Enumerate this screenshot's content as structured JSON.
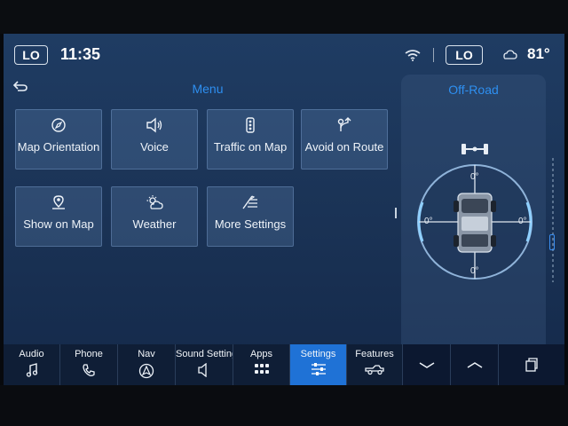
{
  "status": {
    "left_temp_zone": "LO",
    "time": "11:35",
    "right_temp_zone": "LO",
    "outside_temp": "81°"
  },
  "header": {
    "title": "Menu"
  },
  "tiles": [
    {
      "label": "Map Orientation",
      "icon": "compass-icon"
    },
    {
      "label": "Voice",
      "icon": "speaker-icon"
    },
    {
      "label": "Traffic on Map",
      "icon": "traffic-light-icon"
    },
    {
      "label": "Avoid on Route",
      "icon": "detour-icon"
    },
    {
      "label": "Show on Map",
      "icon": "map-pin-icon"
    },
    {
      "label": "Weather",
      "icon": "sun-cloud-icon"
    },
    {
      "label": "More Settings",
      "icon": "settings-list-icon"
    }
  ],
  "offroad": {
    "title": "Off-Road",
    "pitch_top": "0°",
    "roll_left": "0°",
    "roll_right": "0°",
    "pitch_bottom": "0°"
  },
  "nav": {
    "items": [
      {
        "label": "Audio",
        "icon": "music-note-icon"
      },
      {
        "label": "Phone",
        "icon": "phone-icon"
      },
      {
        "label": "Nav",
        "icon": "navigation-icon"
      },
      {
        "label": "Sound Settings",
        "icon": "speaker-icon"
      },
      {
        "label": "Apps",
        "icon": "apps-grid-icon"
      },
      {
        "label": "Settings",
        "icon": "sliders-icon"
      },
      {
        "label": "Features",
        "icon": "truck-icon"
      }
    ],
    "active": "Settings"
  },
  "colors": {
    "accent": "#2e8ff0",
    "active_tab": "#1f72d6"
  }
}
